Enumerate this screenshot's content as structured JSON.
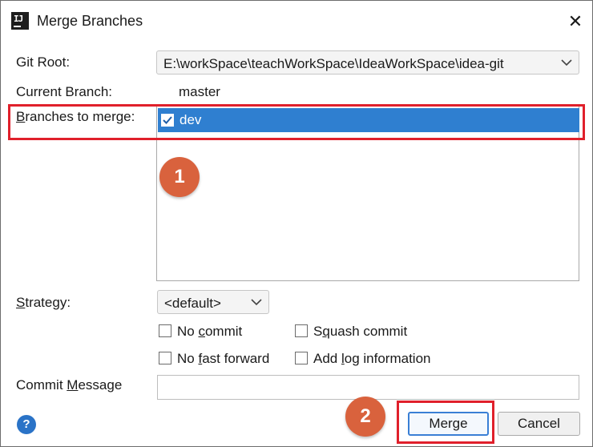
{
  "window": {
    "title": "Merge Branches"
  },
  "form": {
    "git_root": {
      "label": "Git Root:",
      "value": "E:\\workSpace\\teachWorkSpace\\IdeaWorkSpace\\idea-git"
    },
    "current_branch": {
      "label": "Current Branch:",
      "value": "master"
    },
    "branches": {
      "label_lead": "B",
      "label_rest": "ranches to merge:",
      "items": [
        {
          "label": "dev",
          "checked": true
        }
      ]
    },
    "strategy": {
      "label_lead": "S",
      "label_rest": "trategy:",
      "value": "<default>"
    },
    "options": {
      "no_commit": {
        "pre": "No ",
        "ul": "c",
        "post": "ommit",
        "checked": false
      },
      "squash_commit": {
        "pre": "S",
        "ul": "q",
        "post": "uash commit",
        "checked": false
      },
      "no_fast_forward": {
        "pre": "No ",
        "ul": "f",
        "post": "ast forward",
        "checked": false
      },
      "add_log": {
        "pre": "Add ",
        "ul": "l",
        "post": "og information",
        "checked": false
      }
    },
    "commit_message": {
      "pre": "Commit ",
      "ul": "M",
      "post": "essage",
      "value": ""
    }
  },
  "footer": {
    "help": "?",
    "merge_label": "Merge",
    "cancel_label": "Cancel"
  },
  "annotations": {
    "step1": "1",
    "step2": "2"
  },
  "colors": {
    "selection": "#2f7fd0",
    "highlight": "#e0202b",
    "badge": "#d9623d",
    "primary_border": "#3a7fd5"
  }
}
